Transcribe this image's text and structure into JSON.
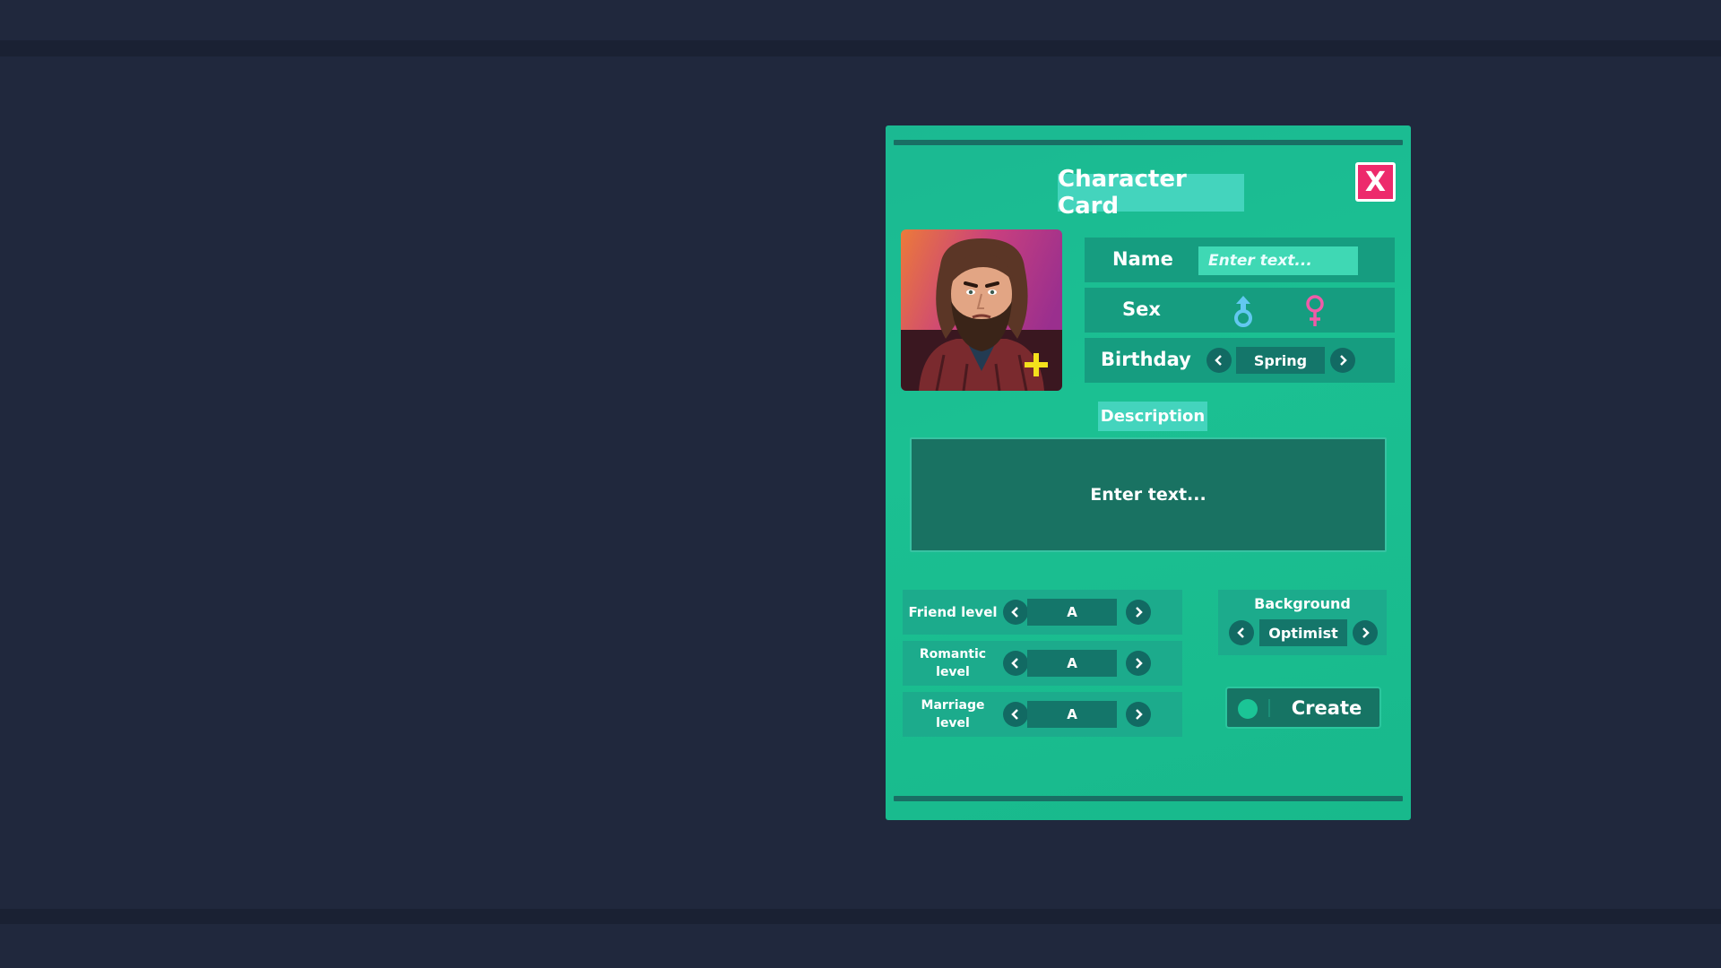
{
  "card": {
    "title": "Character Card",
    "close_label": "X",
    "name": {
      "label": "Name",
      "placeholder": "Enter text..."
    },
    "sex": {
      "label": "Sex",
      "male_icon": "male-symbol-icon",
      "female_icon": "female-symbol-icon"
    },
    "birthday": {
      "label": "Birthday",
      "value": "Spring"
    },
    "description": {
      "label": "Description",
      "placeholder": "Enter text..."
    },
    "levels": {
      "friend": {
        "label": "Friend level",
        "value": "A"
      },
      "romantic": {
        "label": "Romantic level",
        "value": "A"
      },
      "marriage": {
        "label": "Marriage level",
        "value": "A"
      }
    },
    "background": {
      "label": "Background",
      "value": "Optimist"
    },
    "create_label": "Create"
  },
  "colors": {
    "page_bg": "#20283d",
    "card_bg": "#1bbe92",
    "close_button": "#ed2a6c",
    "male_symbol": "#62c8f0",
    "female_symbol": "#f05ba8",
    "add_photo_plus": "#f4e11c"
  }
}
